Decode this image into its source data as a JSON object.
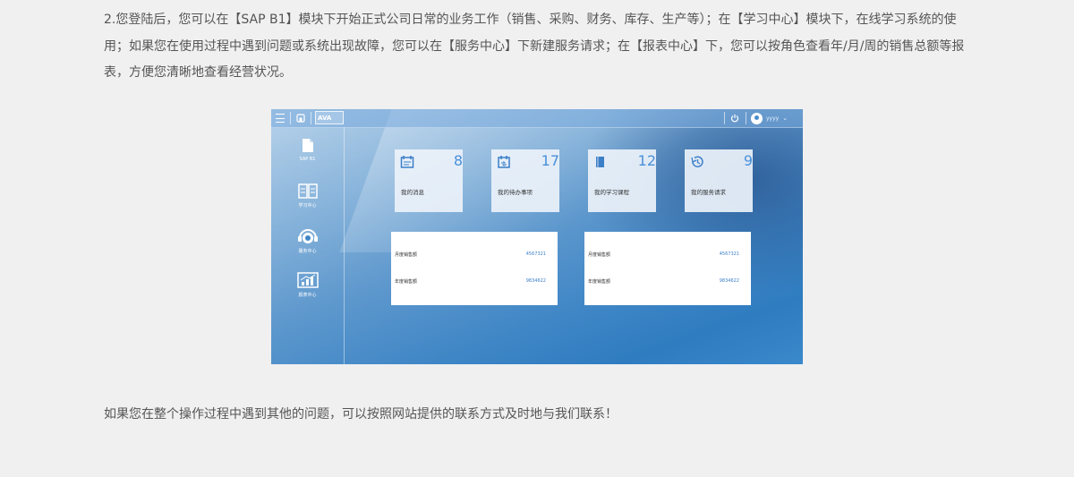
{
  "intro_text": "2.您登陆后，您可以在【SAP B1】模块下开始正式公司日常的业务工作（销售、采购、财务、库存、生产等）；在【学习中心】模块下，在线学习系统的使用；如果您在使用过程中遇到问题或系统出现故障，您可以在【服务中心】下新建服务请求；在【报表中心】下，您可以按角色查看年/月/周的销售总额等报表，方便您清晰地查看经营状况。",
  "app": {
    "logo_text": "AVA",
    "user_name": "yyyy",
    "sidebar": [
      {
        "label": "SAP B1",
        "icon": "document-icon"
      },
      {
        "label": "学习中心",
        "icon": "book-icon"
      },
      {
        "label": "服务中心",
        "icon": "headset-icon"
      },
      {
        "label": "报表中心",
        "icon": "chart-icon"
      }
    ],
    "tiles": [
      {
        "label": "我的消息",
        "count": "8",
        "icon": "message-icon"
      },
      {
        "label": "我的待办事项",
        "count": "17",
        "icon": "calendar-icon"
      },
      {
        "label": "我的学习课程",
        "count": "12",
        "icon": "course-book-icon"
      },
      {
        "label": "我的服务请求",
        "count": "9",
        "icon": "history-icon"
      }
    ],
    "panels": [
      {
        "rows": [
          {
            "label": "月度销售额",
            "value": "4567321"
          },
          {
            "label": "年度销售额",
            "value": "9834622"
          }
        ]
      },
      {
        "rows": [
          {
            "label": "月度销售额",
            "value": "4567321"
          },
          {
            "label": "年度销售额",
            "value": "9834622"
          }
        ]
      }
    ]
  },
  "outro_text": "如果您在整个操作过程中遇到其他的问题，可以按照网站提供的联系方式及时地与我们联系！"
}
